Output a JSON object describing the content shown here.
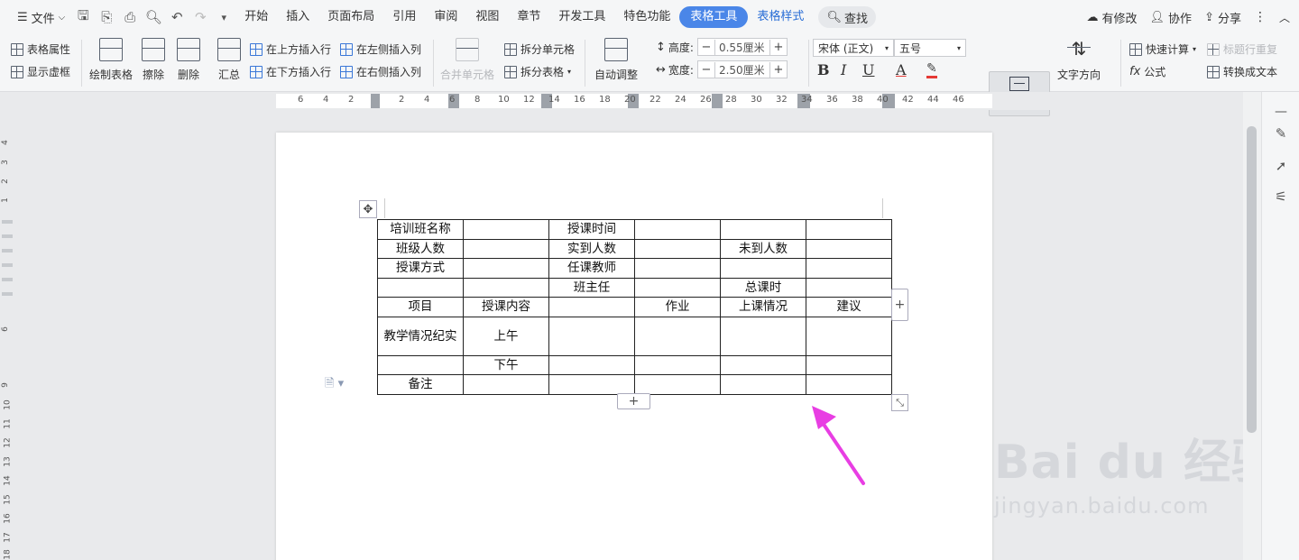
{
  "menu": {
    "file": "文件",
    "tabs": [
      "开始",
      "插入",
      "页面布局",
      "引用",
      "审阅",
      "视图",
      "章节",
      "开发工具",
      "特色功能"
    ],
    "active_tab": "表格工具",
    "style_tab": "表格样式",
    "search": "查找",
    "right": {
      "modified": "有修改",
      "collab": "协作",
      "share": "分享"
    }
  },
  "ribbon": {
    "table_props": "表格属性",
    "show_gridlines": "显示虚框",
    "draw_table": "绘制表格",
    "erase": "擦除",
    "delete": "删除",
    "summary": "汇总",
    "insert_above": "在上方插入行",
    "insert_below": "在下方插入行",
    "insert_left": "在左侧插入列",
    "insert_right": "在右侧插入列",
    "merge_cells": "合并单元格",
    "split_cells": "拆分单元格",
    "split_table": "拆分表格",
    "auto_adjust": "自动调整",
    "height_label": "高度:",
    "height_value": "0.55厘米",
    "width_label": "宽度:",
    "width_value": "2.50厘米",
    "font_name": "宋体 (正文)",
    "font_size": "五号",
    "align": "对齐方式",
    "text_direction": "文字方向",
    "quick_calc": "快速计算",
    "header_repeat": "标题行重复",
    "formula": "公式",
    "to_text": "转换成文本"
  },
  "ruler": {
    "h_numbers": [
      "6",
      "4",
      "2",
      "2",
      "4",
      "6",
      "8",
      "10",
      "12",
      "14",
      "16",
      "18",
      "20",
      "22",
      "24",
      "26",
      "28",
      "30",
      "32",
      "34",
      "36",
      "38",
      "40",
      "42",
      "44",
      "46"
    ],
    "v_numbers": [
      "4",
      "3",
      "2",
      "1",
      "1",
      "6",
      "9",
      "10",
      "11",
      "12",
      "13",
      "14",
      "15",
      "16",
      "17",
      "18"
    ]
  },
  "table": {
    "rows": [
      [
        "培训班名称",
        "",
        "授课时间",
        "",
        "",
        ""
      ],
      [
        "班级人数",
        "",
        "实到人数",
        "",
        "未到人数",
        ""
      ],
      [
        "授课方式",
        "",
        "任课教师",
        "",
        "",
        ""
      ],
      [
        "",
        "",
        "班主任",
        "",
        "总课时",
        ""
      ],
      [
        "项目",
        "授课内容",
        "",
        "作业",
        "上课情况",
        "建议"
      ],
      [
        "教学情况纪实",
        "上午",
        "",
        "",
        "",
        ""
      ],
      [
        "",
        "下午",
        "",
        "",
        "",
        ""
      ],
      [
        "备注",
        "",
        "",
        "",
        "",
        ""
      ]
    ]
  },
  "watermark": {
    "brand": "Bai du 经验",
    "url": "jingyan.baidu.com"
  },
  "colors": {
    "accent": "#4a86e8",
    "arrow": "#e83ee3",
    "ribbon_bg": "#f5f6f7"
  }
}
